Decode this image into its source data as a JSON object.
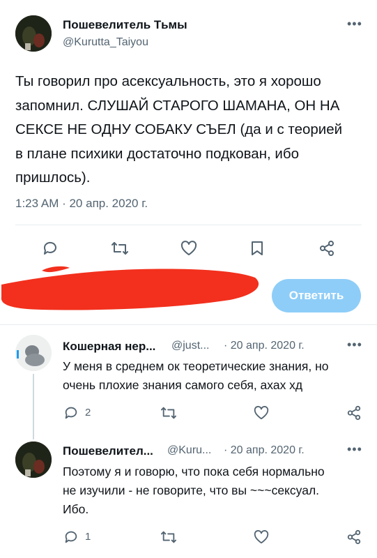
{
  "main_tweet": {
    "display_name": "Пошевелитель Тьмы",
    "handle": "@Kurutta_Taiyou",
    "text": "Ты говорил про асексуальность, это я хорошо\nзапомнил. СЛУШАЙ СТАРОГО ШАМАНА, ОН НА\nСЕКСЕ НЕ ОДНУ СОБАКУ СЪЕЛ (да и с теорией\nв плане психики достаточно подкован, ибо\nпришлось).",
    "timestamp": "1:23 AM · 20 апр. 2020 г."
  },
  "reply_box": {
    "button_label": "Ответить"
  },
  "replies": [
    {
      "display_name": "Кошерная нер...",
      "handle": "@just...",
      "date": "· 20 апр. 2020 г.",
      "text": "У меня в среднем ок теоретические знания, но\nочень плохие знания самого себя, ахах хд",
      "reply_count": "2"
    },
    {
      "display_name": "Пошевелител...",
      "handle": "@Kuru...",
      "date": "· 20 апр. 2020 г.",
      "text": "Поэтому я и говорю, что пока себя нормально\nне изучили - не говорите, что вы ~~~сексуал.\nИбо.",
      "reply_count": "1"
    }
  ],
  "colors": {
    "accent_button": "#8ecdf8",
    "redaction": "#f2301d",
    "icon": "#536471"
  }
}
